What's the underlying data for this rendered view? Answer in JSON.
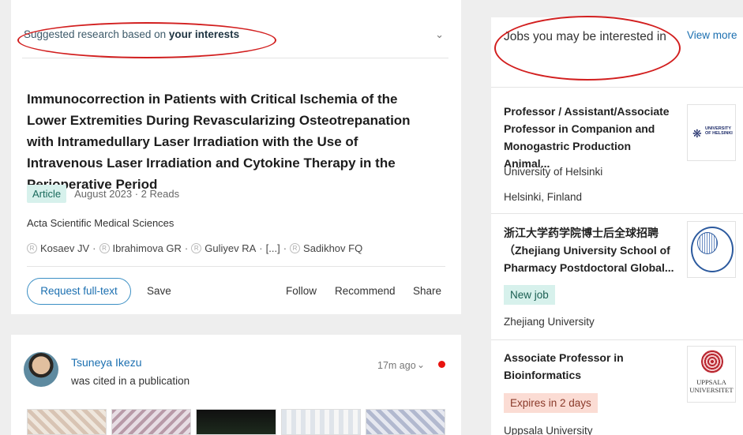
{
  "feed": {
    "suggested": {
      "prefix": "Suggested research based on ",
      "bold": "your interests"
    },
    "publication": {
      "title": "Immunocorrection in Patients with Critical Ischemia of the Lower Extremities During Revascularizing Osteotrepanation with Intramedullary Laser Irradiation with the Use of Intravenous Laser Irradiation and Cytokine Therapy in the Perioperative Period",
      "type": "Article",
      "meta": "August 2023 · 2 Reads",
      "journal": "Acta Scientific Medical Sciences",
      "authors": [
        "Kosaev JV",
        "Ibrahimova GR",
        "Guliyev RA",
        "[...]",
        "Sadikhov FQ"
      ],
      "actions": {
        "request_full_text": "Request full-text",
        "save": "Save",
        "follow": "Follow",
        "recommend": "Recommend",
        "share": "Share"
      }
    },
    "activity": {
      "user": "Tsuneya Ikezu",
      "action": "was cited in a publication",
      "time": "17m ago"
    }
  },
  "jobs": {
    "heading": "Jobs you may be interested in",
    "view_more": "View more",
    "items": [
      {
        "title": "Professor / Assistant/Associate Professor in Companion and Monogastric Production Animal...",
        "org": "University of Helsinki",
        "location": "Helsinki, Finland",
        "logo_text": "UNIVERSITY OF HELSINKI"
      },
      {
        "title": "浙江大学药学院博士后全球招聘 （Zhejiang University School of Pharmacy Postdoctoral Global...",
        "badge": "New job",
        "org": "Zhejiang University"
      },
      {
        "title": "Associate Professor in Bioinformatics",
        "badge": "Expires in 2 days",
        "org": "Uppsala University",
        "logo_text": "UPPSALA UNIVERSITET"
      }
    ]
  },
  "colors": {
    "accent_blue": "#1b6fb0",
    "annotation_red": "#d21f1f",
    "tag_green_bg": "#d7f1ec",
    "tag_red_bg": "#fbdcd4"
  }
}
